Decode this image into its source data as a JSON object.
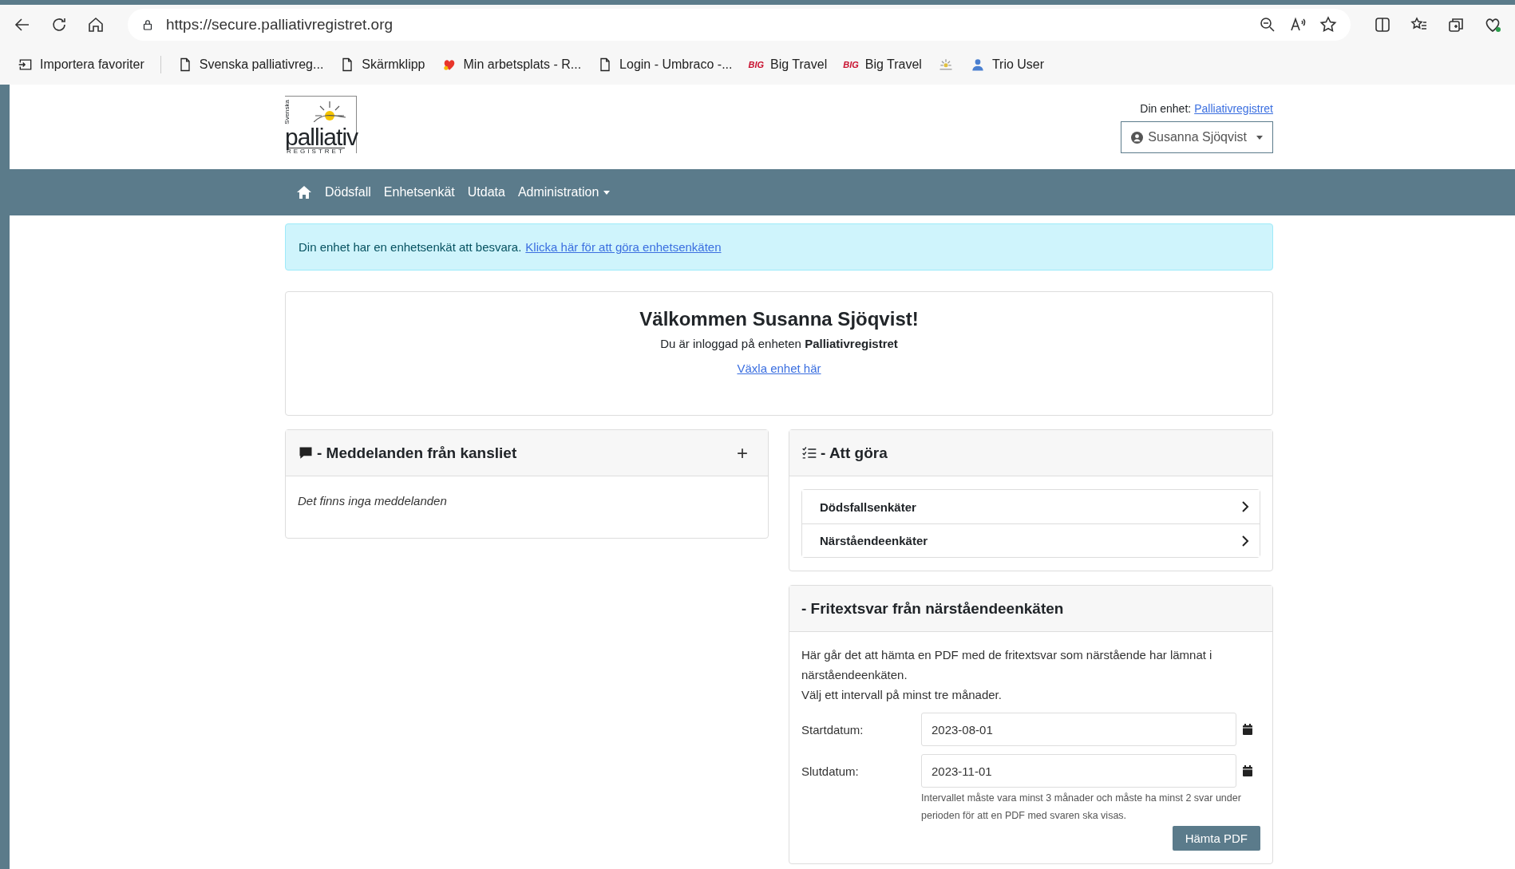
{
  "browser": {
    "url": "https://secure.palliativregistret.org",
    "bookmarks": [
      {
        "kind": "import",
        "label": "Importera favoriter"
      },
      {
        "kind": "page",
        "label": "Svenska palliativreg..."
      },
      {
        "kind": "page",
        "label": "Skärmklipp"
      },
      {
        "kind": "logo",
        "label": "Min arbetsplats - R..."
      },
      {
        "kind": "page",
        "label": "Login - Umbraco -..."
      },
      {
        "kind": "big",
        "badge": "BIG",
        "label": "Big Travel"
      },
      {
        "kind": "big",
        "badge": "BIG",
        "label": "Big Travel"
      },
      {
        "kind": "sun"
      },
      {
        "kind": "user",
        "label": "Trio User"
      }
    ]
  },
  "header": {
    "logo": {
      "top": "Svenska",
      "main": "palliativ",
      "bottom": "REGISTRET"
    },
    "unit_label": "Din enhet:",
    "unit_link": "Palliativregistret",
    "user_menu": "Susanna Sjöqvist"
  },
  "nav": [
    {
      "kind": "home"
    },
    {
      "kind": "link",
      "label": "Dödsfall"
    },
    {
      "kind": "link",
      "label": "Enhetsenkät"
    },
    {
      "kind": "link",
      "label": "Utdata"
    },
    {
      "kind": "dropdown",
      "label": "Administration"
    }
  ],
  "alert": {
    "text": "Din enhet har en enhetsenkät att besvara.",
    "link": "Klicka här för att göra enhetsenkäten"
  },
  "welcome": {
    "title": "Välkommen Susanna Sjöqvist!",
    "text": "Du är inloggad på enheten **Palliativregistret**",
    "link": "Växla enhet här"
  },
  "messages": {
    "title": "- Meddelanden från kansliet",
    "add": "+",
    "empty": "Det finns inga meddelanden"
  },
  "todo": {
    "title": "- Att göra",
    "items": [
      {
        "label": "Dödsfallsenkäter"
      },
      {
        "label": "Närståendeenkäter"
      }
    ]
  },
  "freetext": {
    "title": "- Fritextsvar från närståendeenkäten",
    "description": "Här går det att hämta en PDF med de fritextsvar som närstående har lämnat i närståendeenkäten.",
    "hint": "Välj ett intervall på minst tre månader.",
    "fields": [
      {
        "label": "Startdatum:",
        "value": "2023-08-01"
      },
      {
        "label": "Slutdatum:",
        "value": "2023-11-01"
      }
    ],
    "help": "Intervallet måste vara minst 3 månader och måste ha minst 2 svar under perioden för att en PDF med svaren ska visas.",
    "button": "Hämta PDF"
  }
}
